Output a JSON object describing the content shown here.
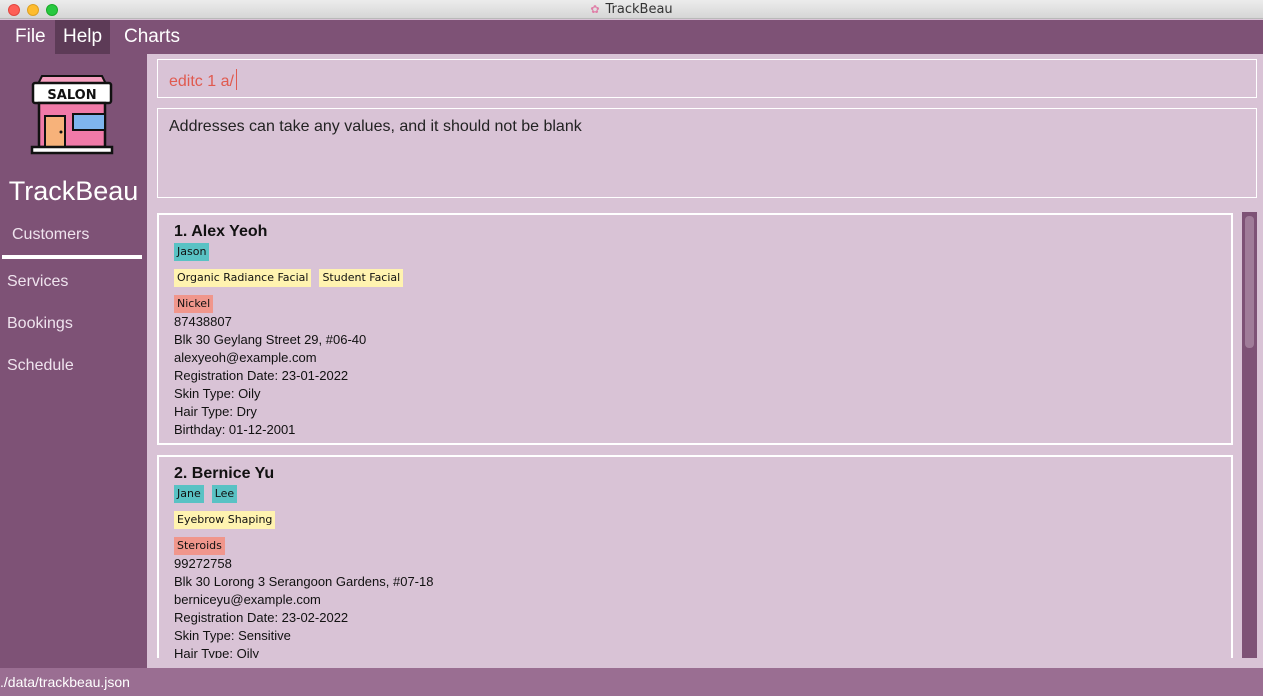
{
  "window": {
    "title": "TrackBeau"
  },
  "menu": {
    "file": "File",
    "help": "Help",
    "charts": "Charts"
  },
  "sidebar": {
    "logo_text": "SALON",
    "app_name": "TrackBeau",
    "items": [
      "Customers",
      "Services",
      "Bookings",
      "Schedule"
    ]
  },
  "command": {
    "value": "editc 1 a/"
  },
  "result": {
    "message": "Addresses can take any values, and it should not be blank"
  },
  "customers": [
    {
      "name": "1.  Alex Yeoh",
      "staff": [
        "Jason"
      ],
      "services": [
        "Organic Radiance Facial",
        "Student Facial"
      ],
      "allergies": [
        "Nickel"
      ],
      "phone": "87438807",
      "address": "Blk 30 Geylang Street 29, #06-40",
      "email": "alexyeoh@example.com",
      "registration": "Registration Date: 23-01-2022",
      "skin": "Skin Type: Oily",
      "hair": "Hair Type: Dry",
      "birthday": "Birthday: 01-12-2001"
    },
    {
      "name": "2.  Bernice Yu",
      "staff": [
        "Jane",
        "Lee"
      ],
      "services": [
        "Eyebrow Shaping"
      ],
      "allergies": [
        "Steroids"
      ],
      "phone": "99272758",
      "address": "Blk 30 Lorong 3 Serangoon Gardens, #07-18",
      "email": "berniceyu@example.com",
      "registration": "Registration Date: 23-02-2022",
      "skin": "Skin Type: Sensitive",
      "hair": "Hair Type: Oily"
    }
  ],
  "status": {
    "path": "./data/trackbeau.json"
  },
  "colors": {
    "primary": "#7e5276",
    "panel": "#d9c3d6",
    "error": "#e05a4f",
    "staff_tag": "#59c2c4",
    "service_tag": "#fff3b0",
    "allergy_tag": "#f0968c"
  }
}
